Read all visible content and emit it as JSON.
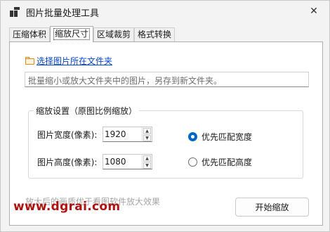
{
  "window": {
    "title": "图片批量处理工具",
    "close_symbol": "✕"
  },
  "tabs": [
    {
      "label": "压缩体积"
    },
    {
      "label": "缩放尺寸"
    },
    {
      "label": "区域裁剪"
    },
    {
      "label": "格式转换"
    }
  ],
  "panel": {
    "select_folder_label": "选择图片所在文件夹",
    "description": "批量缩小或放大文件夹中的图片，另存到新文件夹。",
    "group_title": "缩放设置（原图比例缩放）",
    "width_label": "图片宽度(像素):",
    "width_value": "1920",
    "height_label": "图片高度(像素):",
    "height_value": "1080",
    "radio_width_label": "优先匹配宽度",
    "radio_height_label": "优先匹配高度",
    "radio_selected": "width",
    "hint": "放大后的画质优于看图软件放大效果",
    "start_button": "开始缩放"
  },
  "watermark": "www.dgrai.com",
  "colors": {
    "accent": "#0067c0",
    "link": "#0645c8",
    "watermark": "#b01212"
  }
}
